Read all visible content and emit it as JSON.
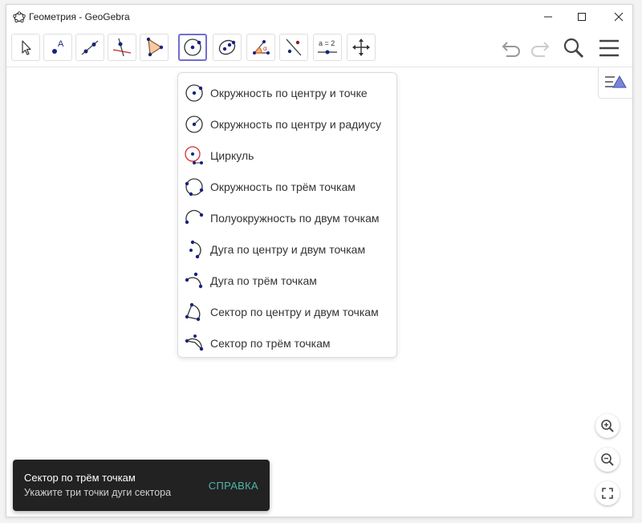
{
  "window": {
    "title": "Геометрия - GeoGebra"
  },
  "toolbar": {
    "tools": [
      {
        "name": "move",
        "icon": "cursor-arrow-icon"
      },
      {
        "name": "point",
        "icon": "point-icon",
        "label": "A"
      },
      {
        "name": "line",
        "icon": "line-icon"
      },
      {
        "name": "perpendicular-line",
        "icon": "perpendicular-line-icon"
      },
      {
        "name": "polygon",
        "icon": "polygon-icon"
      },
      {
        "name": "circle-center-point",
        "icon": "circle-center-point-icon",
        "active": true
      },
      {
        "name": "ellipse",
        "icon": "ellipse-icon"
      },
      {
        "name": "angle",
        "icon": "angle-icon",
        "label": "α"
      },
      {
        "name": "reflect",
        "icon": "reflect-icon"
      },
      {
        "name": "slider",
        "icon": "slider-icon",
        "label": "a = 2"
      },
      {
        "name": "move-graphics-view",
        "icon": "move-graphics-view-icon"
      }
    ]
  },
  "circle_menu": {
    "items": [
      {
        "label": "Окружность по центру и точке",
        "icon": "circle-center-point-icon"
      },
      {
        "label": "Окружность по центру и радиусу",
        "icon": "circle-center-radius-icon"
      },
      {
        "label": "Циркуль",
        "icon": "compass-icon"
      },
      {
        "label": "Окружность по трём точкам",
        "icon": "circle-three-points-icon"
      },
      {
        "label": "Полуокружность по двум точкам",
        "icon": "semicircle-icon"
      },
      {
        "label": "Дуга по центру и двум точкам",
        "icon": "arc-center-icon"
      },
      {
        "label": "Дуга по трём точкам",
        "icon": "arc-three-points-icon"
      },
      {
        "label": "Сектор по центру и двум точкам",
        "icon": "sector-center-icon"
      },
      {
        "label": "Сектор по трём точкам",
        "icon": "sector-three-points-icon"
      }
    ]
  },
  "tooltip": {
    "title": "Сектор по трём точкам",
    "description": "Укажите три точки дуги сектора",
    "action": "СПРАВКА"
  },
  "colors": {
    "accent": "#6f6fcf",
    "point": "#1a237e",
    "compass": "#d32f2f",
    "action": "#4db6ac"
  }
}
